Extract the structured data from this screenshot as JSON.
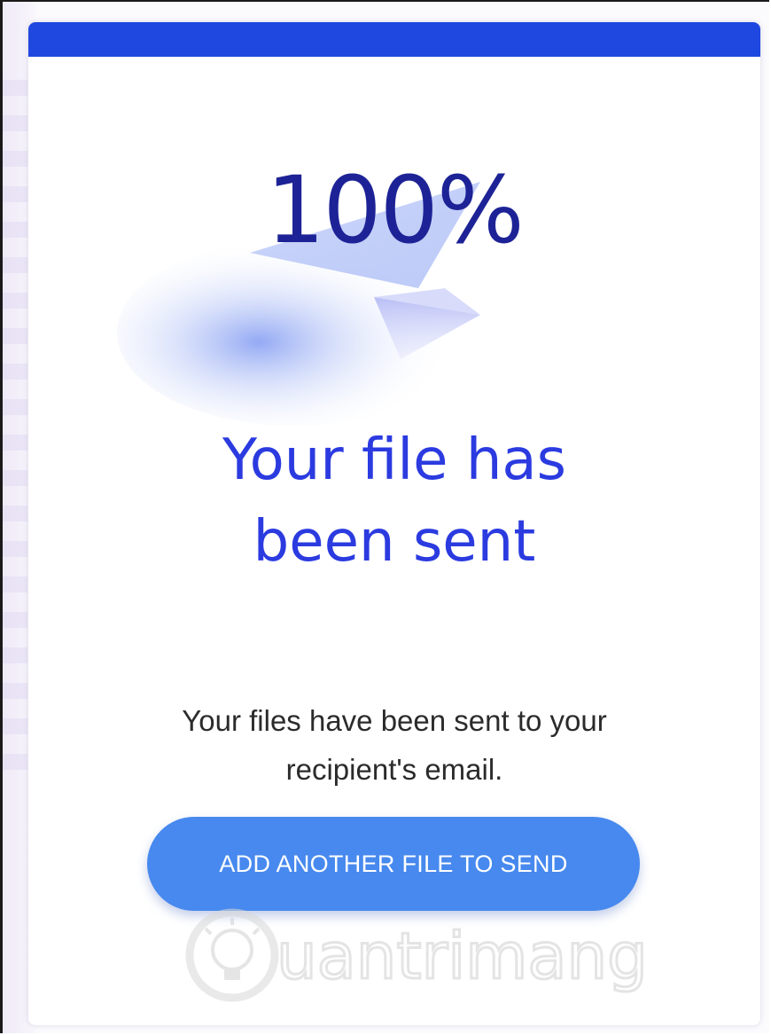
{
  "progress": {
    "label": "100%",
    "value": 100
  },
  "confirmation": {
    "headline_line1": "Your file has",
    "headline_line2": "been sent",
    "description": "Your files have been sent to your recipient's email."
  },
  "actions": {
    "add_another_label": "ADD ANOTHER FILE TO SEND"
  },
  "watermark": {
    "text": "uantrimang"
  },
  "colors": {
    "top_bar": "#1f48e0",
    "percent_text": "#1d2396",
    "headline_text": "#2b3be0",
    "button_bg": "#4789ee"
  },
  "icons": [
    "paper-plane-icon",
    "lightbulb-icon"
  ]
}
